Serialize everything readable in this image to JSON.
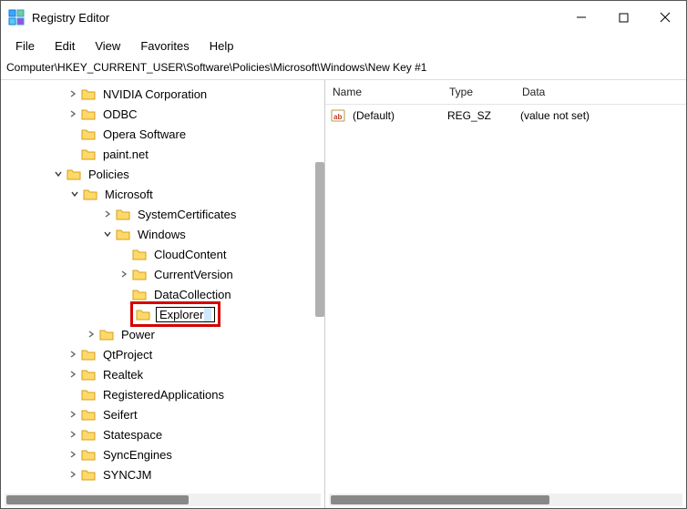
{
  "window": {
    "title": "Registry Editor"
  },
  "menus": {
    "file": "File",
    "edit": "Edit",
    "view": "View",
    "favorites": "Favorites",
    "help": "Help"
  },
  "address": "Computer\\HKEY_CURRENT_USER\\Software\\Policies\\Microsoft\\Windows\\New Key #1",
  "tree": {
    "n0": "NVIDIA Corporation",
    "n1": "ODBC",
    "n2": "Opera Software",
    "n3": "paint.net",
    "n4": "Policies",
    "n5": "Microsoft",
    "n6": "SystemCertificates",
    "n7": "Windows",
    "n8": "CloudContent",
    "n9": "CurrentVersion",
    "n10": "DataCollection",
    "n11": "Explorer",
    "n12": "Power",
    "n13": "QtProject",
    "n14": "Realtek",
    "n15": "RegisteredApplications",
    "n16": "Seifert",
    "n17": "Statespace",
    "n18": "SyncEngines",
    "n19": "SYNCJM"
  },
  "list": {
    "headers": {
      "name": "Name",
      "type": "Type",
      "data": "Data"
    },
    "rows": [
      {
        "name": "(Default)",
        "type": "REG_SZ",
        "data": "(value not set)"
      }
    ]
  }
}
